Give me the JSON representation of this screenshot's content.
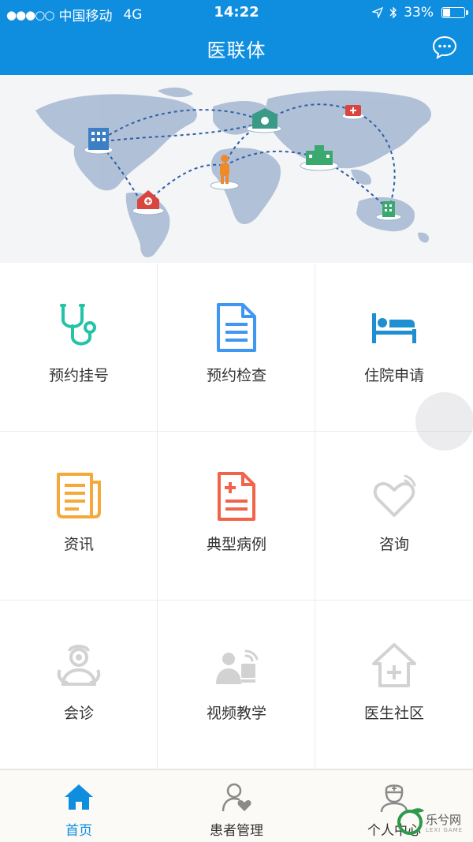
{
  "status_bar": {
    "signal": "●●●○○",
    "carrier": "中国移动",
    "network": "4G",
    "time": "14:22",
    "battery": "33%",
    "battery_level": 0.33
  },
  "nav": {
    "title": "医联体",
    "chat_icon": "chat-bubble-icon"
  },
  "banner": {
    "image": "world-map-hospital-network"
  },
  "grid": [
    {
      "label": "预约挂号",
      "icon": "stethoscope-icon",
      "color": "#23c3a6"
    },
    {
      "label": "预约检查",
      "icon": "document-icon",
      "color": "#3e97f0"
    },
    {
      "label": "住院申请",
      "icon": "hospital-bed-icon",
      "color": "#1e8fd0"
    },
    {
      "label": "资讯",
      "icon": "news-icon",
      "color": "#f5a93a"
    },
    {
      "label": "典型病例",
      "icon": "medical-record-icon",
      "color": "#f2644a"
    },
    {
      "label": "咨询",
      "icon": "heart-chat-icon",
      "color": "#cfcfcf"
    },
    {
      "label": "会诊",
      "icon": "doctor-consult-icon",
      "color": "#cfcfcf"
    },
    {
      "label": "视频教学",
      "icon": "video-teaching-icon",
      "color": "#cfcfcf"
    },
    {
      "label": "医生社区",
      "icon": "community-house-icon",
      "color": "#cfcfcf"
    }
  ],
  "tabbar": {
    "tabs": [
      {
        "label": "首页",
        "icon": "home-icon",
        "active": true
      },
      {
        "label": "患者管理",
        "icon": "patient-heart-icon",
        "active": false
      },
      {
        "label": "个人中心",
        "icon": "nurse-profile-icon",
        "active": false
      }
    ]
  },
  "watermark": {
    "text": "乐兮网",
    "sub": "LEXI GAME"
  },
  "colors": {
    "primary": "#0f8ee0",
    "tab_active": "#0f8ee0",
    "banner_bg": "#f4f5f7"
  }
}
